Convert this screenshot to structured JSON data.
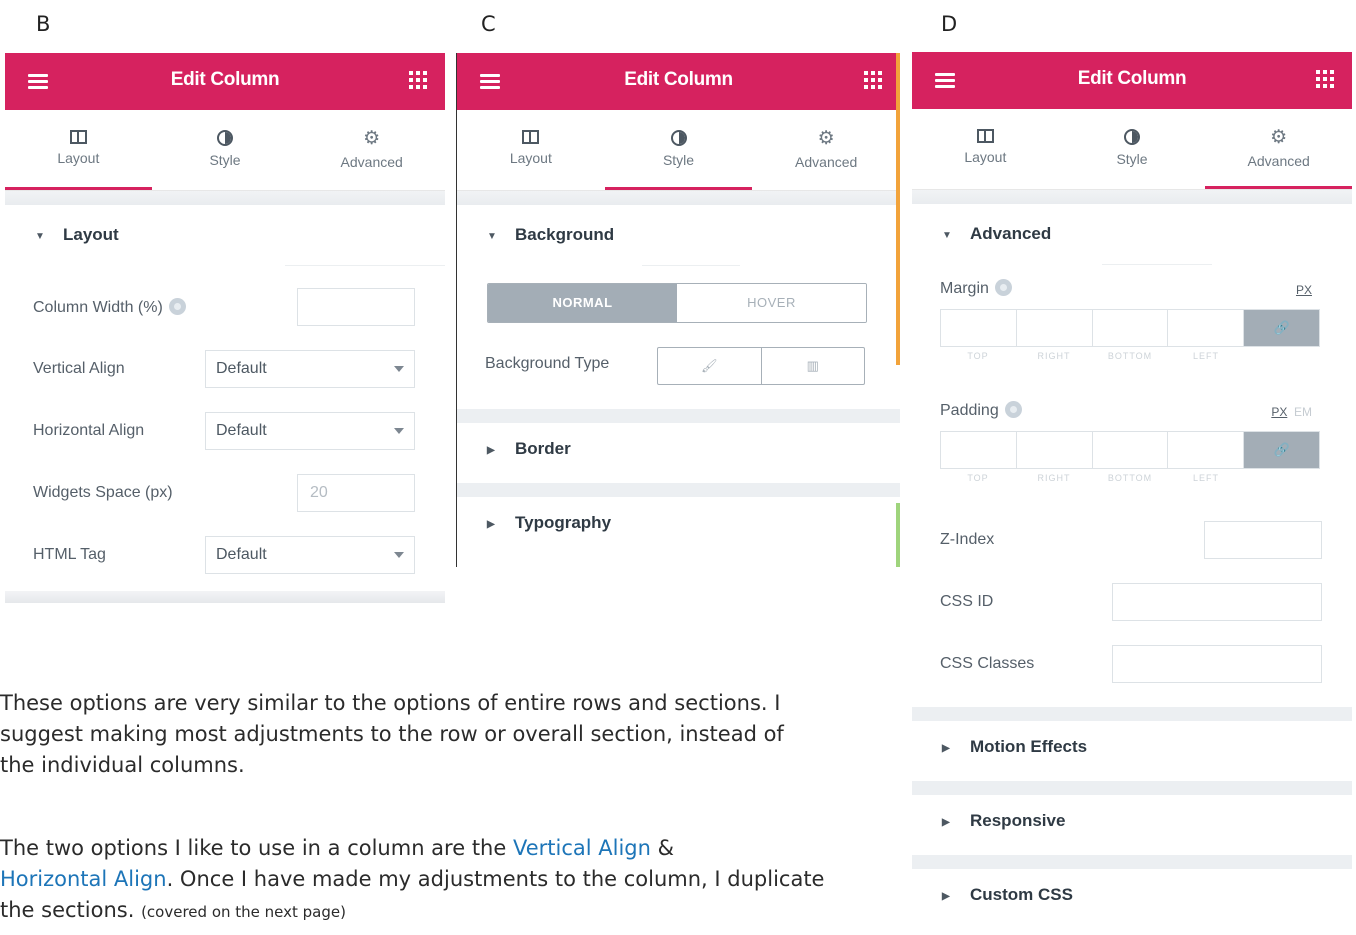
{
  "letters": {
    "b": "B",
    "c": "C",
    "d": "D"
  },
  "editor": {
    "title": "Edit Column",
    "tabs": {
      "layout": "Layout",
      "style": "Style",
      "advanced": "Advanced"
    }
  },
  "panel_b": {
    "section": "Layout",
    "fields": {
      "column_width": "Column Width (%)",
      "vertical_align": "Vertical Align",
      "vertical_align_value": "Default",
      "horizontal_align": "Horizontal Align",
      "horizontal_align_value": "Default",
      "widgets_space": "Widgets Space (px)",
      "widgets_space_value": "20",
      "html_tag": "HTML Tag",
      "html_tag_value": "Default"
    }
  },
  "panel_c": {
    "section": "Background",
    "normal": "NORMAL",
    "hover": "HOVER",
    "background_type": "Background Type",
    "border": "Border",
    "typography": "Typography"
  },
  "panel_d": {
    "section": "Advanced",
    "margin": "Margin",
    "padding": "Padding",
    "unit_px": "PX",
    "unit_em": "EM",
    "dim_labels": [
      "TOP",
      "RIGHT",
      "BOTTOM",
      "LEFT"
    ],
    "z_index": "Z-Index",
    "css_id": "CSS ID",
    "css_classes": "CSS Classes",
    "motion_effects": "Motion Effects",
    "responsive": "Responsive",
    "custom_css": "Custom CSS"
  },
  "body_text": {
    "p1": "These options are very similar to the options of entire rows and sections. I suggest making most adjustments to the row or overall section, instead of the individual columns.",
    "p2_a": "The two options I like to use in a column are the",
    "p2_link1": "Vertical Align",
    "p2_amp": "&",
    "p2_link2": "Horizontal Align",
    "p2_b": ". Once I have made my adjustments to the column, I duplicate the sections.",
    "p2_note": "(covered on the next page)"
  },
  "colors": {
    "brand": "#d6225f",
    "link": "#1d75b8",
    "accent_orange": "#f2a33a",
    "accent_green": "#9fd47c"
  }
}
